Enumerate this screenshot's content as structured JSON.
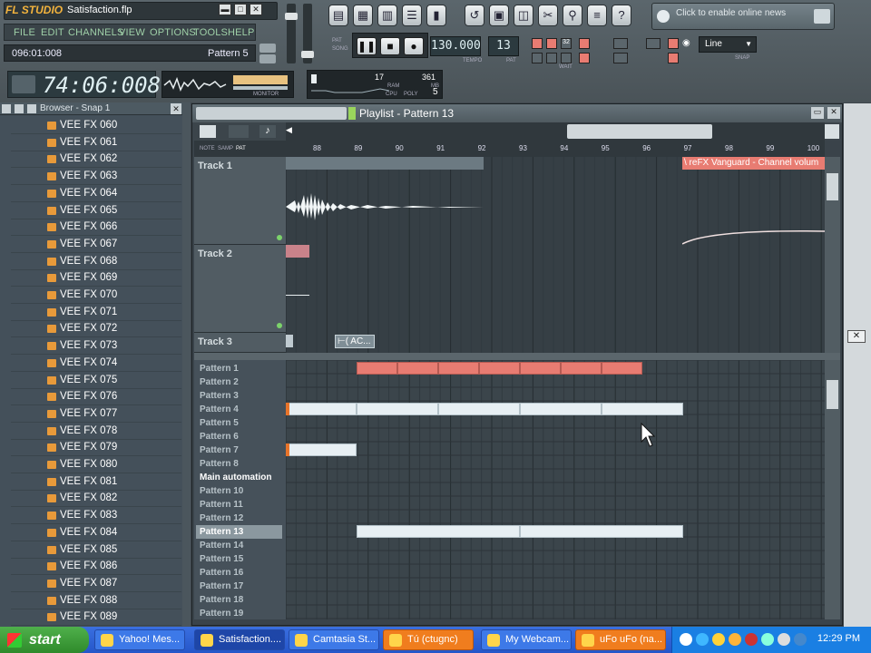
{
  "app": {
    "logo": "FL STUDIO",
    "song_file": "Satisfaction.flp",
    "menu": [
      "FILE",
      "EDIT",
      "CHANNELS",
      "VIEW",
      "OPTIONS",
      "TOOLS",
      "HELP"
    ],
    "hint_left": "096:01:008",
    "hint_right": "Pattern 5",
    "time": "74:06:008",
    "tempo": "130.000",
    "tempo_label": "TEMPO",
    "pattern": "13",
    "pattern_label": "PAT",
    "pat_song": [
      "PAT",
      "SONG"
    ],
    "cpu": {
      "ram": "17",
      "poly_value": "361",
      "cpu_label": "CPU",
      "poly_label": "POLY",
      "poly": "5",
      "ram_label": "RAM",
      "mb_label": "MB"
    },
    "monitor_label": "MONITOR",
    "news": "Click to enable online news",
    "snap": "Line",
    "snap_label": "SNAP",
    "wait_label": "WAIT"
  },
  "browser": {
    "title": "Browser - Snap 1",
    "items": [
      "VEE FX 060",
      "VEE FX 061",
      "VEE FX 062",
      "VEE FX 063",
      "VEE FX 064",
      "VEE FX 065",
      "VEE FX 066",
      "VEE FX 067",
      "VEE FX 068",
      "VEE FX 069",
      "VEE FX 070",
      "VEE FX 071",
      "VEE FX 072",
      "VEE FX 073",
      "VEE FX 074",
      "VEE FX 075",
      "VEE FX 076",
      "VEE FX 077",
      "VEE FX 078",
      "VEE FX 079",
      "VEE FX 080",
      "VEE FX 081",
      "VEE FX 082",
      "VEE FX 083",
      "VEE FX 084",
      "VEE FX 085",
      "VEE FX 086",
      "VEE FX 087",
      "VEE FX 088",
      "VEE FX 089"
    ]
  },
  "playlist": {
    "title": "Playlist - Pattern 13",
    "tabs": [
      "NOTE",
      "SAMP",
      "PAT"
    ],
    "ruler": [
      "88",
      "89",
      "90",
      "91",
      "92",
      "93",
      "94",
      "95",
      "96",
      "97",
      "98",
      "99",
      "100"
    ],
    "tracks": [
      "Track 1",
      "Track 2",
      "Track 3"
    ],
    "clip_automation": "\\ reFX Vanguard - Channel volum",
    "clip_ac": "⊢( AC...",
    "patterns": [
      "Pattern 1",
      "Pattern 2",
      "Pattern 3",
      "Pattern 4",
      "Pattern 5",
      "Pattern 6",
      "Pattern 7",
      "Pattern 8",
      "Main automation",
      "Pattern 10",
      "Pattern 11",
      "Pattern 12",
      "Pattern 13",
      "Pattern 14",
      "Pattern 15",
      "Pattern 16",
      "Pattern 17",
      "Pattern 18",
      "Pattern 19"
    ],
    "selected_pattern": "Pattern 13"
  },
  "taskbar": {
    "start": "start",
    "tasks": [
      "Yahoo! Mes...",
      "Satisfaction....",
      "Camtasia St...",
      "Tú (ctugnc)",
      "My Webcam...",
      "uFo uFo (na..."
    ],
    "clock": "12:29 PM"
  },
  "colors": {
    "accent_red": "#e87c72",
    "clip_white": "#e7eff3",
    "lcd": "#2c3a3f",
    "taskbar": "#2556c9"
  }
}
